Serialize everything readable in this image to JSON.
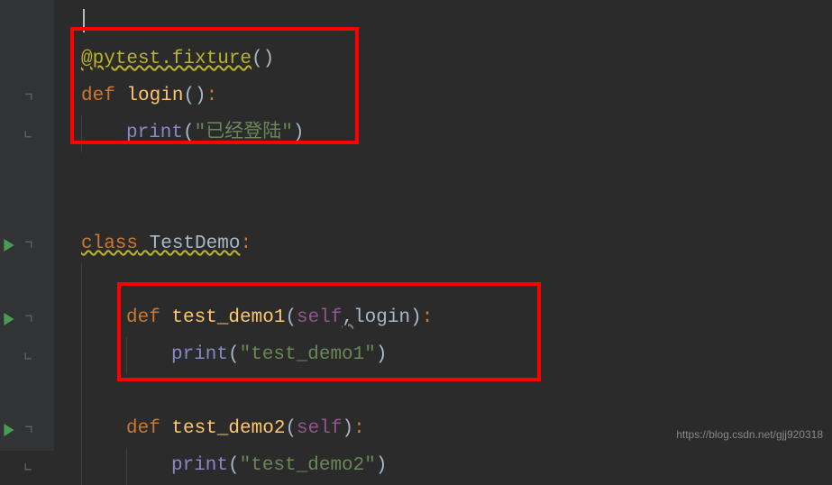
{
  "gutter": {
    "run_icon": "run"
  },
  "code": {
    "line1": {
      "decorator_at": "@",
      "decorator_name": "pytest.fixture",
      "paren_open": "(",
      "paren_close": ")"
    },
    "line2": {
      "def_kw": "def",
      "fname": " login",
      "params": "()",
      "colon": ":"
    },
    "line3": {
      "print_fn": "print",
      "paren_open": "(",
      "string": "\"已经登陆\"",
      "paren_close": ")"
    },
    "line4": {
      "class_kw": "class",
      "class_name": " TestDemo",
      "colon": ":"
    },
    "line5": {
      "def_kw": "def",
      "fname": " test_demo1",
      "paren_open": "(",
      "self_kw": "self",
      "comma": ",",
      "param": "login",
      "paren_close": ")",
      "colon": ":"
    },
    "line6": {
      "print_fn": "print",
      "paren_open": "(",
      "string": "\"test_demo1\"",
      "paren_close": ")"
    },
    "line7": {
      "def_kw": "def",
      "fname": " test_demo2",
      "paren_open": "(",
      "self_kw": "self",
      "paren_close": ")",
      "colon": ":"
    },
    "line8": {
      "print_fn": "print",
      "paren_open": "(",
      "string": "\"test_demo2\"",
      "paren_close": ")"
    }
  },
  "watermark": {
    "text": "https://blog.csdn.net/gjj920318"
  }
}
